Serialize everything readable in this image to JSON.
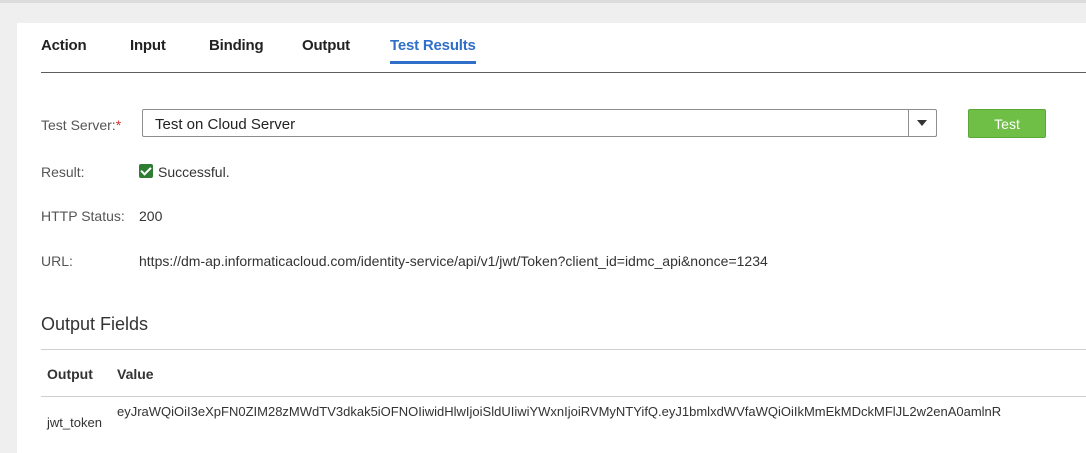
{
  "tabs": [
    {
      "label": "Action"
    },
    {
      "label": "Input"
    },
    {
      "label": "Binding"
    },
    {
      "label": "Output"
    },
    {
      "label": "Test Results"
    }
  ],
  "form": {
    "test_server_label": "Test Server:",
    "required_mark": "*",
    "test_server_value": "Test on Cloud Server",
    "test_button": "Test",
    "result_label": "Result:",
    "result_value": "Successful.",
    "http_status_label": "HTTP Status:",
    "http_status_value": "200",
    "url_label": "URL:",
    "url_value": "https://dm-ap.informaticacloud.com/identity-service/api/v1/jwt/Token?client_id=idmc_api&nonce=1234"
  },
  "output": {
    "title": "Output Fields",
    "columns": [
      "Output",
      "Value"
    ],
    "rows": [
      {
        "output": "jwt_token",
        "value": "eyJraWQiOiI3eXpFN0ZIM28zMWdTV3dkak5iOFNOIiwidHlwIjoiSldUIiwiYWxnIjoiRVMyNTYifQ.eyJ1bmlxdWVfaWQiOiIkMmEkMDckMFlJL2w2enA0amlnR"
      }
    ]
  },
  "colors": {
    "accent": "#2f6fc7",
    "test_button": "#6fbf46",
    "success": "#2e7d32",
    "required": "#d32f2f"
  }
}
